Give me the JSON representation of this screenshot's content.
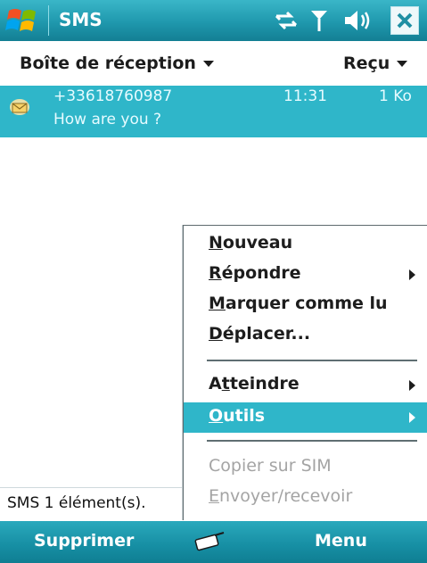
{
  "titlebar": {
    "title": "SMS",
    "icons": [
      "windows-start-icon",
      "connectivity-icon",
      "signal-icon",
      "volume-icon",
      "close-icon"
    ]
  },
  "header": {
    "folder_label": "Boîte de réception",
    "sort_label": "Reçu"
  },
  "messages": [
    {
      "from": "+33618760987",
      "time": "11:31",
      "size": "1 Ko",
      "preview": "How are you ?",
      "icon": "envelope-icon"
    }
  ],
  "statusline": {
    "text": "SMS 1 élément(s)."
  },
  "menu": {
    "items": [
      {
        "label": "Nouveau",
        "accel": "N",
        "rest": "ouveau",
        "submenu": false,
        "enabled": true,
        "selected": false
      },
      {
        "label": "Répondre",
        "accel": "R",
        "rest": "épondre",
        "submenu": true,
        "enabled": true,
        "selected": false
      },
      {
        "label": "Marquer comme lu",
        "accel": "M",
        "rest": "arquer comme lu",
        "submenu": false,
        "enabled": true,
        "selected": false
      },
      {
        "label": "Déplacer...",
        "accel": "D",
        "rest": "éplacer...",
        "submenu": false,
        "enabled": true,
        "selected": false
      },
      {
        "label": "Atteindre",
        "accel_pre": "A",
        "accel": "t",
        "rest": "teindre",
        "submenu": true,
        "enabled": true,
        "selected": false
      },
      {
        "label": "Outils",
        "accel": "O",
        "rest": "utils",
        "submenu": true,
        "enabled": true,
        "selected": true
      },
      {
        "label": "Copier sur SIM",
        "submenu": false,
        "enabled": false,
        "selected": false
      },
      {
        "label": "Envoyer/recevoir",
        "accel": "E",
        "rest": "nvoyer/recevoir",
        "submenu": false,
        "enabled": false,
        "selected": false
      }
    ]
  },
  "softkeys": {
    "left": "Supprimer",
    "right": "Menu",
    "middle_icon": "keyboard-icon"
  },
  "colors": {
    "accent": "#2fb6c9",
    "titlebar": "#1f98ad",
    "disabled_text": "#a4a4a4"
  }
}
